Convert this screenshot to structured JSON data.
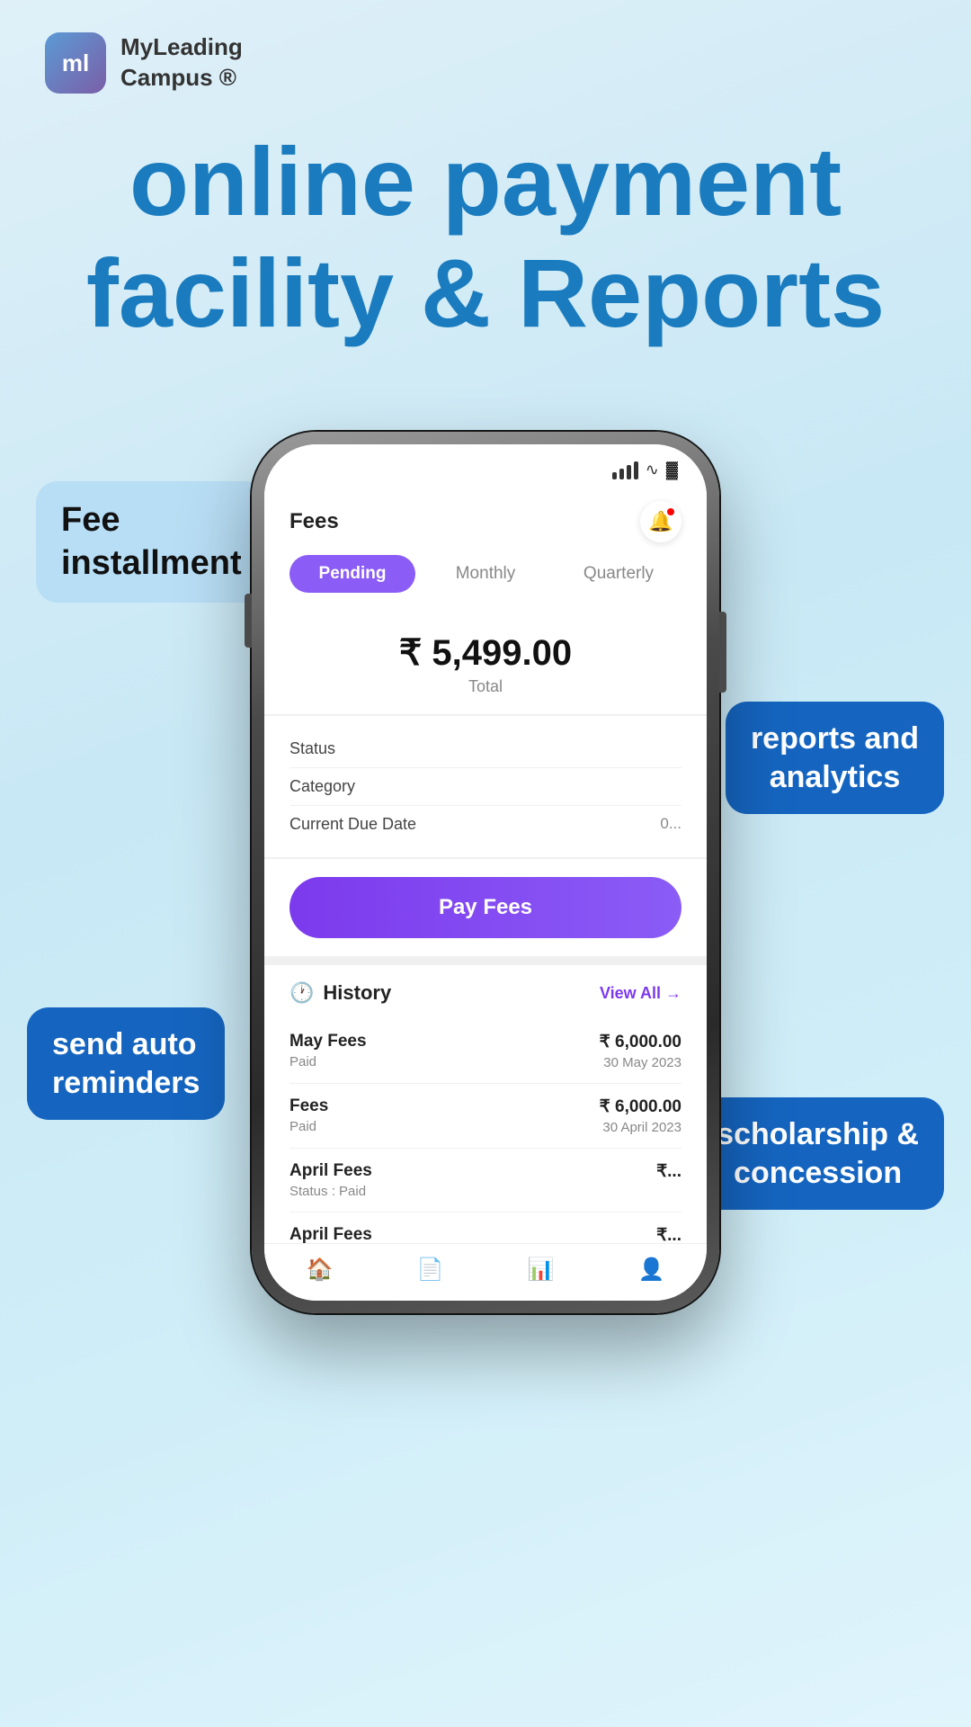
{
  "brand": {
    "logo_text": "ml",
    "name_line1": "MyLeading",
    "name_line2": "Campus ®"
  },
  "hero": {
    "title_line1": "online payment",
    "title_line2": "facility & Reports"
  },
  "bubbles": {
    "fee_installment": "Fee\ninstallment",
    "reports_analytics": "reports and\nanalytics",
    "send_auto_reminders": "send auto\nreminders",
    "scholarship_concession": "scholarship &\nconcession"
  },
  "app": {
    "title": "Fees",
    "notification_count": "1"
  },
  "tabs": [
    {
      "label": "Pending",
      "active": true
    },
    {
      "label": "Monthly",
      "active": false
    },
    {
      "label": "Quarterly",
      "active": false
    }
  ],
  "amount": {
    "value": "₹ 5,499.00",
    "label": "Total"
  },
  "info_rows": [
    {
      "label": "Status",
      "value": ""
    },
    {
      "label": "Category",
      "value": ""
    },
    {
      "label": "Current Due Date",
      "value": "0..."
    }
  ],
  "pay_button": {
    "label": "Pay Fees"
  },
  "history": {
    "title": "History",
    "view_all": "View All →",
    "items": [
      {
        "name": "May Fees",
        "status": "Paid",
        "amount": "₹ 6,000.00",
        "date": "30 May 2023"
      },
      {
        "name": "Fees",
        "status": "Paid",
        "amount": "₹ 6,000.00",
        "date": "30 April 2023"
      },
      {
        "name": "April Fees",
        "status": "Status : Paid",
        "amount": "₹...",
        "date": ""
      },
      {
        "name": "April Fees",
        "status": "",
        "amount": "₹...",
        "date": ""
      }
    ]
  },
  "bottom_nav": [
    {
      "icon": "🏠",
      "label": "home",
      "active": true
    },
    {
      "icon": "📄",
      "label": "documents",
      "active": false
    },
    {
      "icon": "📊",
      "label": "analytics",
      "active": false
    },
    {
      "icon": "👤",
      "label": "profile",
      "active": false
    }
  ]
}
